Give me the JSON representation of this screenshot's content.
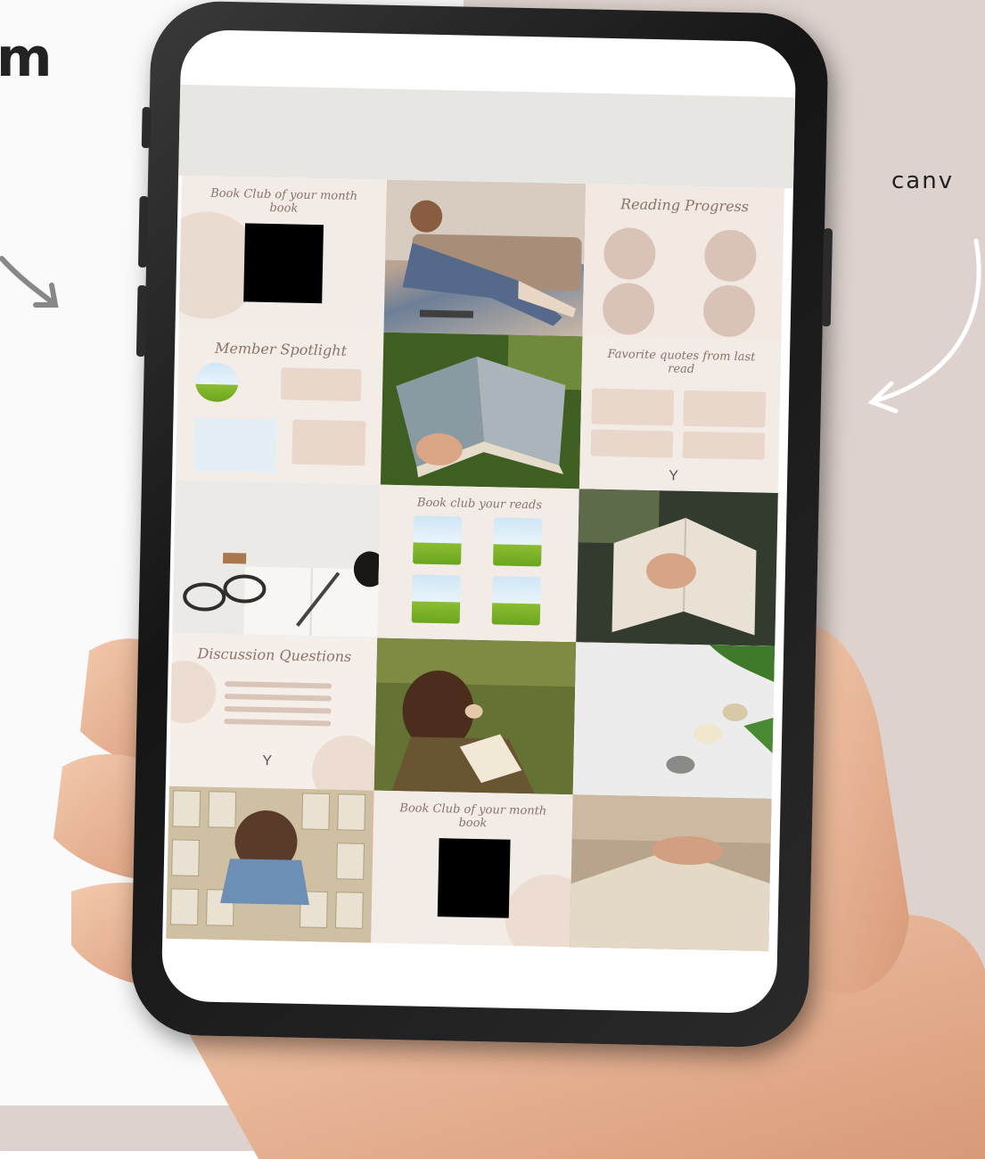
{
  "decor": {
    "left_text": "m",
    "right_text": "canv"
  },
  "tiles": {
    "book_club_title_1": "Book Club of your month book",
    "book_club_title_2": "Book Club of your month book",
    "reading_progress_title": "Reading Progress",
    "member_spotlight_title": "Member Spotlight",
    "favorite_quotes_title": "Favorite quotes from last read",
    "book_club_reads_title": "Book club your reads",
    "discussion_title": "Discussion Questions"
  },
  "colors": {
    "phone_frame": "#1c1c1c",
    "screen_header": "#e8e6e3",
    "tile_beige": "#f1e6df",
    "accent_taupe": "#8a7468"
  },
  "icons": {
    "leaf": "sprout-icon"
  }
}
